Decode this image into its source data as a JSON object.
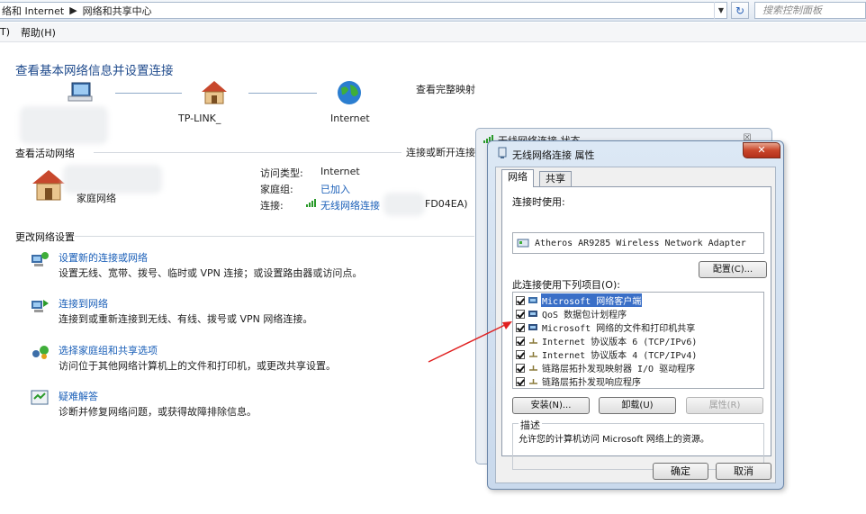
{
  "address_bar": {
    "path": [
      "络和 Internet",
      "网络和共享中心"
    ],
    "search_placeholder": "搜索控制面板"
  },
  "menu_bar": {
    "items": [
      "T)",
      "帮助(H)"
    ]
  },
  "main": {
    "title": "查看基本网络信息并设置连接",
    "map": {
      "router_name": "TP-LINK_",
      "internet_label": "Internet",
      "view_full_map": "查看完整映射"
    },
    "active_networks": {
      "section_title": "查看活动网络",
      "connect_disconnect": "连接或断开连接",
      "network_type": "家庭网络",
      "access_type_label": "访问类型:",
      "access_type_value": "Internet",
      "homegroup_label": "家庭组:",
      "homegroup_value": "已加入",
      "connection_label": "连接:",
      "connection_value": "无线网络连接",
      "connection_suffix": "FD04EA)"
    },
    "change_settings": {
      "section_title": "更改网络设置",
      "tasks": [
        {
          "link": "设置新的连接或网络",
          "desc": "设置无线、宽带、拨号、临时或 VPN 连接；或设置路由器或访问点。"
        },
        {
          "link": "连接到网络",
          "desc": "连接到或重新连接到无线、有线、拨号或 VPN 网络连接。"
        },
        {
          "link": "选择家庭组和共享选项",
          "desc": "访问位于其他网络计算机上的文件和打印机，或更改共享设置。"
        },
        {
          "link": "疑难解答",
          "desc": "诊断并修复网络问题，或获得故障排除信息。"
        }
      ]
    }
  },
  "status_window": {
    "title": "无线网络连接 状态",
    "close": "☒"
  },
  "dialog": {
    "title": "无线网络连接 属性",
    "close": "✕",
    "tabs": [
      "网络",
      "共享"
    ],
    "connect_using_label": "连接时使用:",
    "adapter": "Atheros AR9285 Wireless Network Adapter",
    "configure_button": "配置(C)...",
    "items_label": "此连接使用下列项目(O):",
    "items": [
      {
        "text": "Microsoft 网络客户端",
        "selected": true
      },
      {
        "text": "QoS 数据包计划程序",
        "selected": false
      },
      {
        "text": "Microsoft 网络的文件和打印机共享",
        "selected": false
      },
      {
        "text": "Internet 协议版本 6 (TCP/IPv6)",
        "selected": false
      },
      {
        "text": "Internet 协议版本 4 (TCP/IPv4)",
        "selected": false
      },
      {
        "text": "链路层拓扑发现映射器 I/O 驱动程序",
        "selected": false
      },
      {
        "text": "链路层拓扑发现响应程序",
        "selected": false
      }
    ],
    "install_button": "安装(N)...",
    "uninstall_button": "卸载(U)",
    "properties_button": "属性(R)",
    "description_label": "描述",
    "description_text": "允许您的计算机访问 Microsoft 网络上的资源。",
    "ok_button": "确定",
    "cancel_button": "取消"
  },
  "colors": {
    "link": "#1a5fb8",
    "title": "#1e4a8c",
    "selection": "#3a6fc7",
    "arrow": "#e02020"
  }
}
